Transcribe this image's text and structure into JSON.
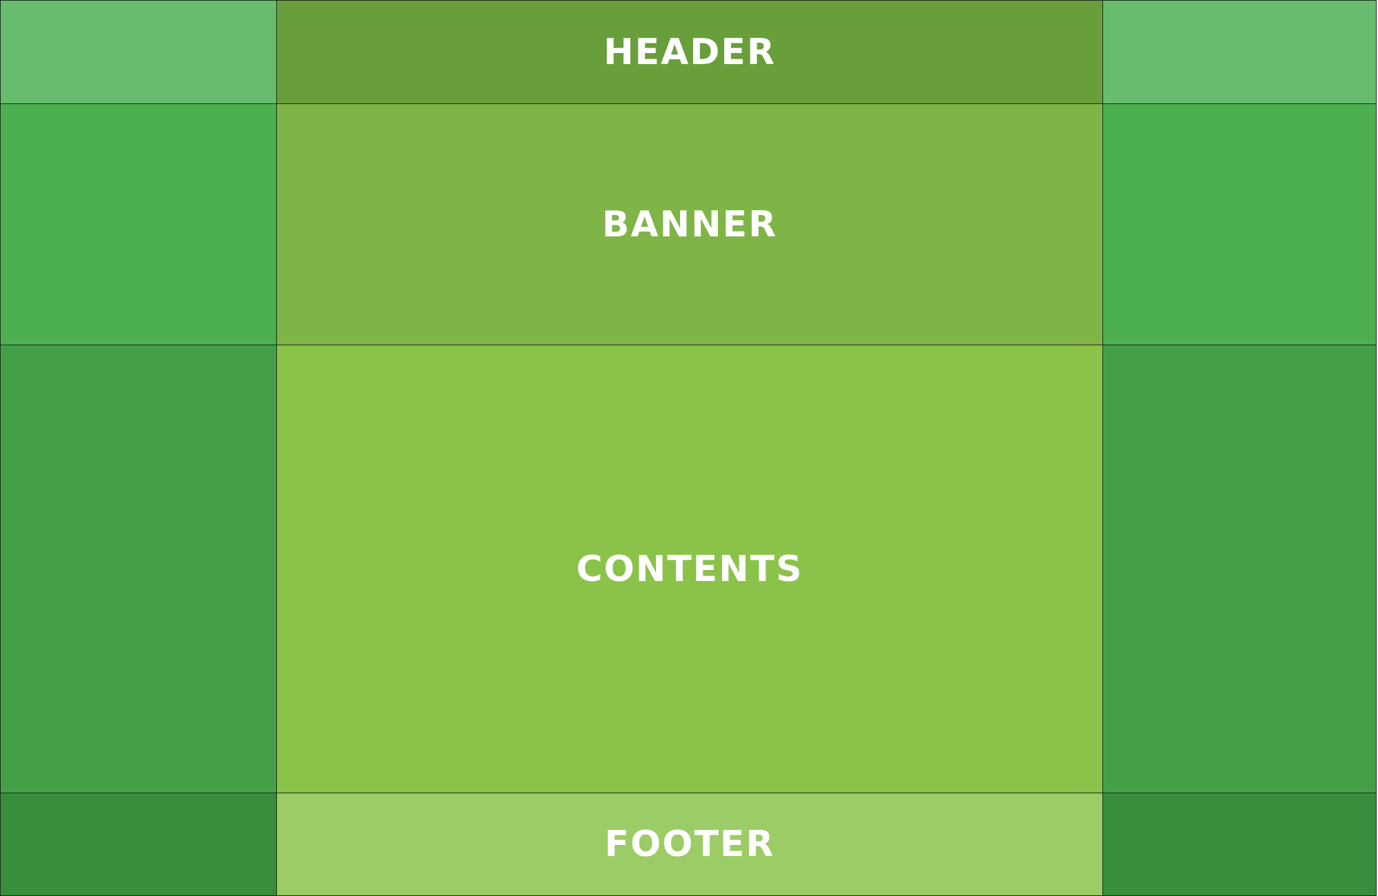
{
  "colors": {
    "header_side": "#68bc6e",
    "header_main": "#699f3a",
    "banner_side": "#4caf50",
    "banner_main": "#7fb446",
    "content_side": "#43a047",
    "content_main": "#8bc34a",
    "footer_side": "#388e3c",
    "footer_main": "#9ccc65"
  },
  "sections": {
    "header": "HEADER",
    "banner": "BANNER",
    "contents": "CONTENTS",
    "footer": "FOOTER"
  }
}
